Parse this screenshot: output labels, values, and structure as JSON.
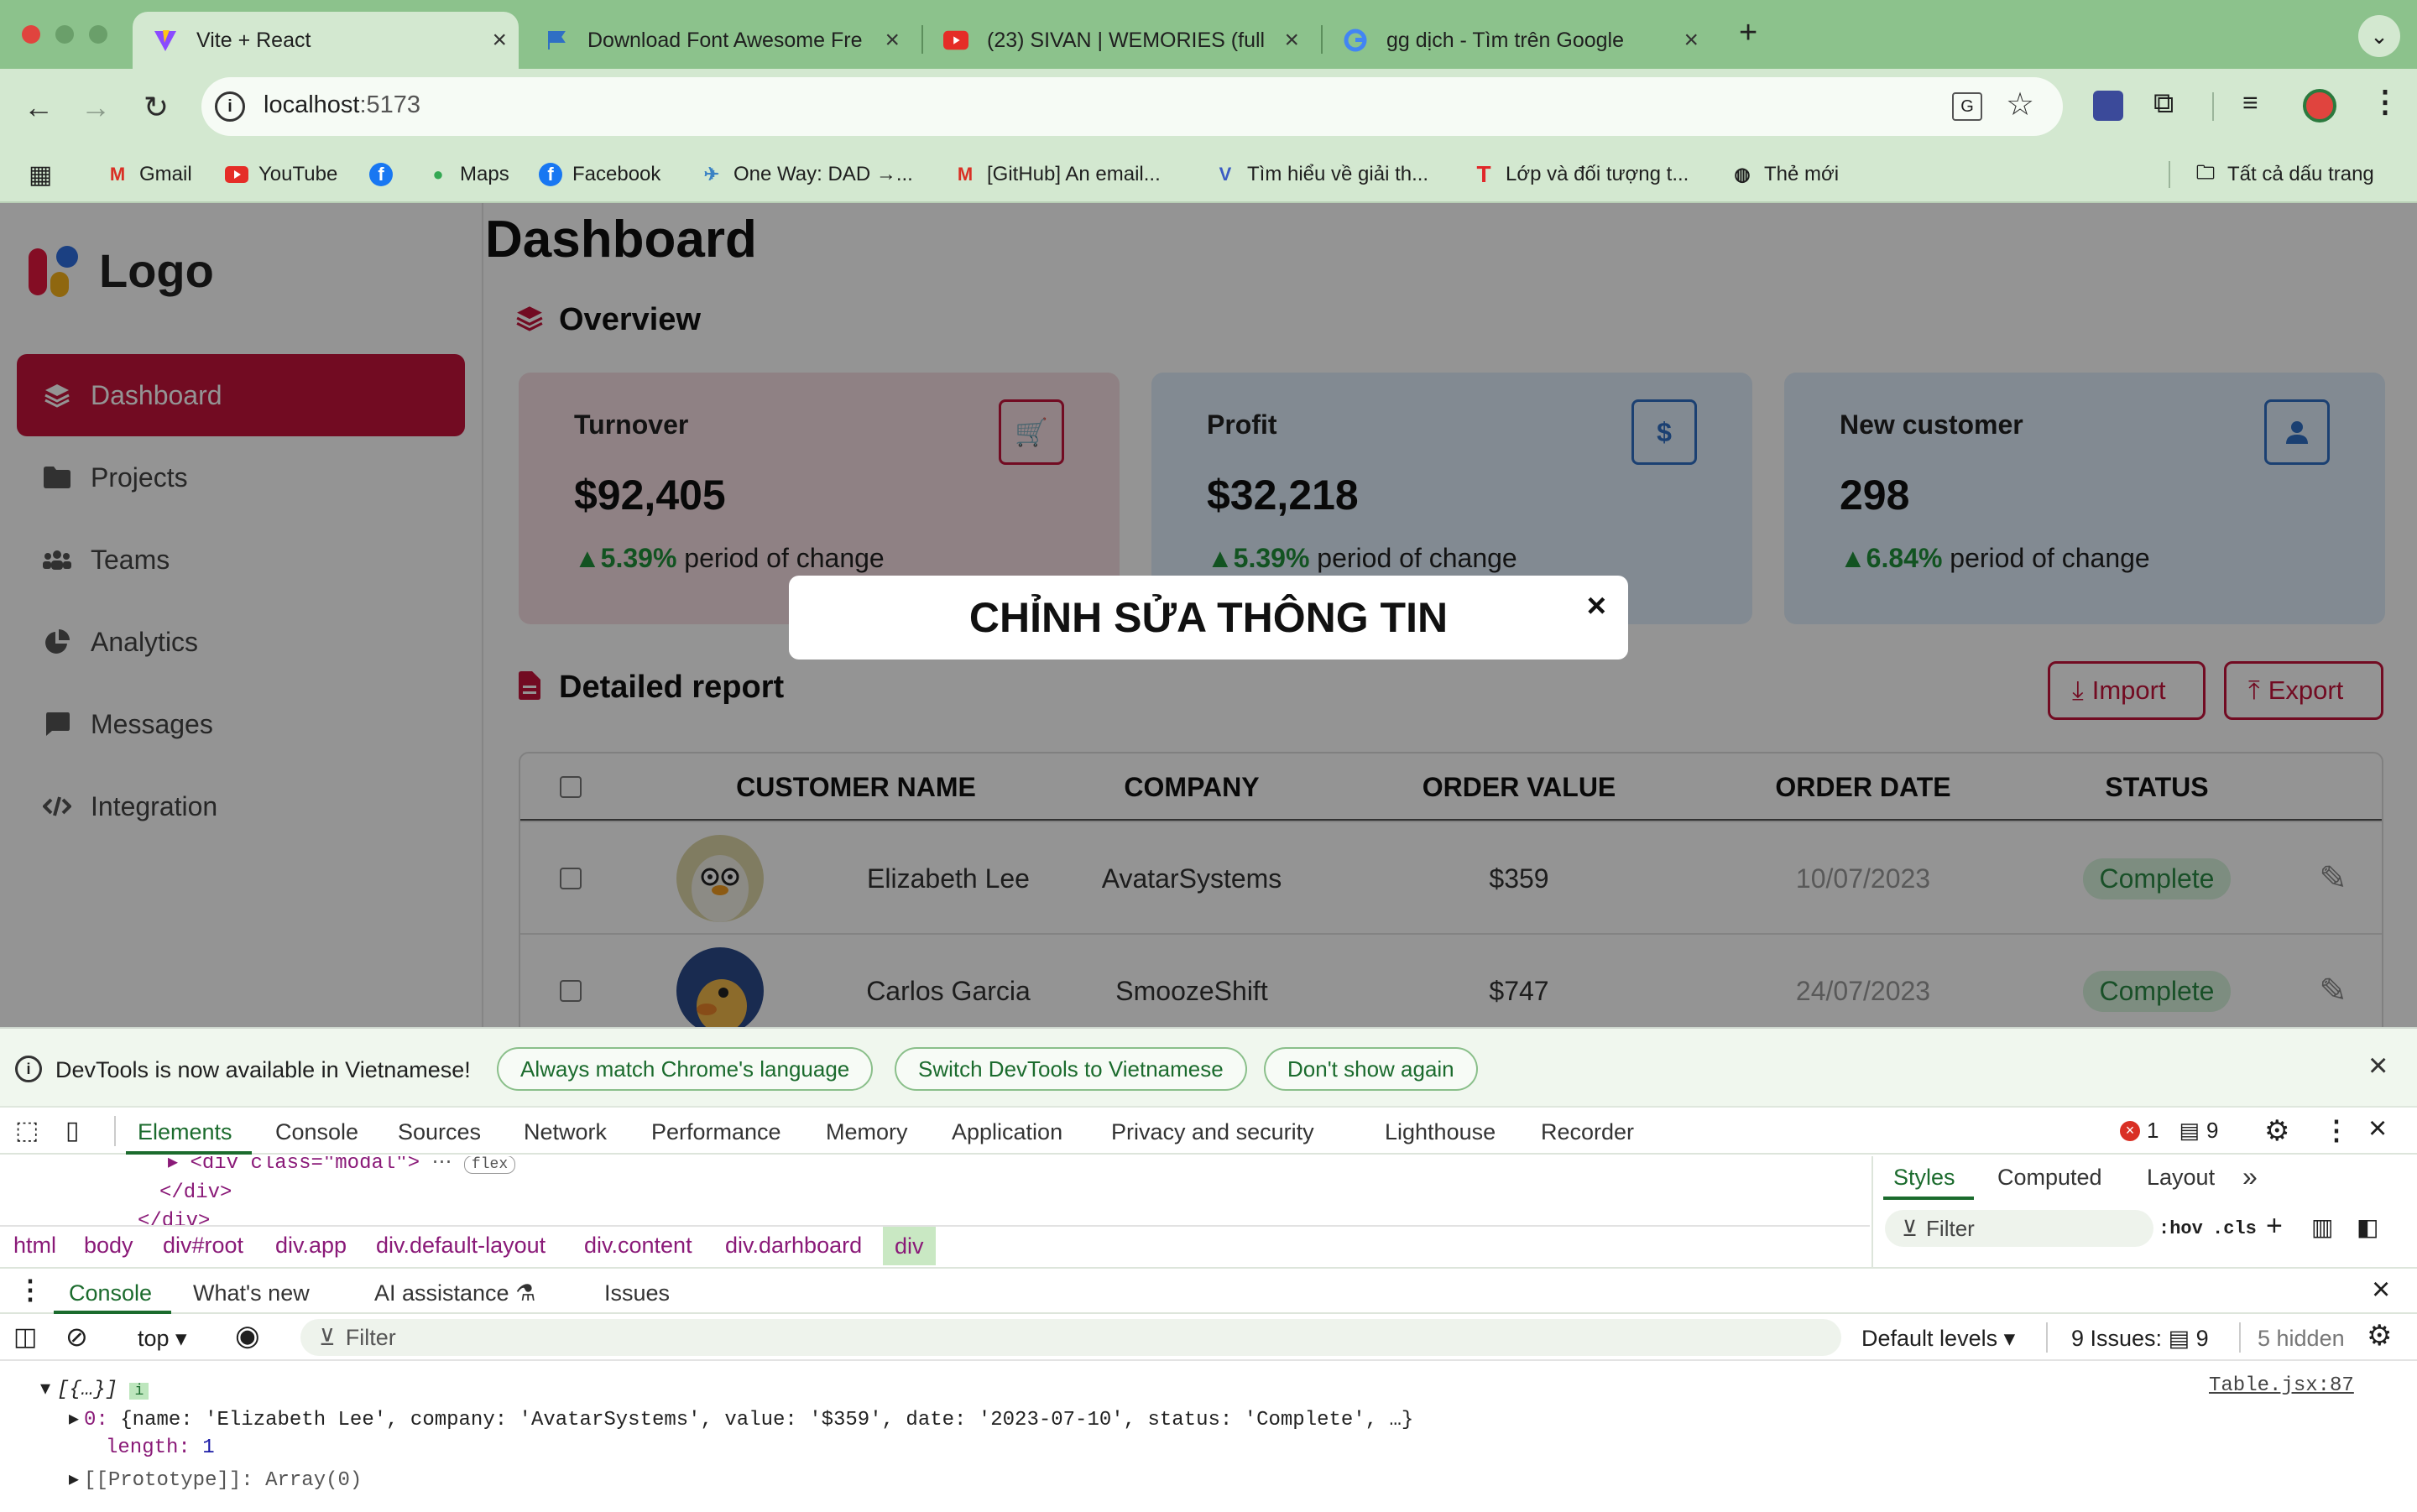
{
  "browser": {
    "tabs": [
      {
        "title": "Vite + React",
        "active": true
      },
      {
        "title": "Download Font Awesome Fre",
        "active": false
      },
      {
        "title": "(23) SIVAN | WEMORIES (full",
        "active": false
      },
      {
        "title": "gg dịch - Tìm trên Google",
        "active": false
      }
    ],
    "new_tab": "+",
    "address": "localhost",
    "address_port": ":5173",
    "bookmarks": [
      "Gmail",
      "YouTube",
      "",
      "Maps",
      "Facebook",
      "One Way: DAD →...",
      "[GitHub] An email...",
      "Tìm hiểu về giải th...",
      "Lớp và đối tượng t...",
      "Thẻ mới"
    ],
    "all_bookmarks": "Tất cả dấu trang"
  },
  "app": {
    "logo_text": "Logo",
    "page_title": "Dashboard",
    "sidebar": [
      {
        "label": "Dashboard",
        "icon": "layers-icon",
        "active": true
      },
      {
        "label": "Projects",
        "icon": "folder-icon"
      },
      {
        "label": "Teams",
        "icon": "users-icon"
      },
      {
        "label": "Analytics",
        "icon": "pie-chart-icon"
      },
      {
        "label": "Messages",
        "icon": "message-icon"
      },
      {
        "label": "Integration",
        "icon": "code-icon"
      }
    ],
    "overview_title": "Overview",
    "cards": [
      {
        "label": "Turnover",
        "value": "$92,405",
        "change": "5.39%",
        "change_text": "period of change",
        "icon": "cart-icon",
        "color": "#c4143c"
      },
      {
        "label": "Profit",
        "value": "$32,218",
        "change": "5.39%",
        "change_text": "period of change",
        "icon": "dollar-icon",
        "color": "#2f6fc4"
      },
      {
        "label": "New customer",
        "value": "298",
        "change": "6.84%",
        "change_text": "period of change",
        "icon": "user-icon",
        "color": "#2f6fc4"
      }
    ],
    "report_title": "Detailed report",
    "import_label": "Import",
    "export_label": "Export",
    "table": {
      "headers": [
        "CUSTOMER NAME",
        "COMPANY",
        "ORDER VALUE",
        "ORDER DATE",
        "STATUS"
      ],
      "rows": [
        {
          "name": "Elizabeth Lee",
          "company": "AvatarSystems",
          "value": "$359",
          "date": "10/07/2023",
          "status": "Complete"
        },
        {
          "name": "Carlos Garcia",
          "company": "SmoozeShift",
          "value": "$747",
          "date": "24/07/2023",
          "status": "Complete"
        }
      ]
    },
    "modal_title": "CHỈNH SỬA THÔNG TIN",
    "modal_close": "×"
  },
  "devtools": {
    "info_text": "DevTools is now available in Vietnamese!",
    "info_buttons": [
      "Always match Chrome's language",
      "Switch DevTools to Vietnamese",
      "Don't show again"
    ],
    "tabs": [
      "Elements",
      "Console",
      "Sources",
      "Network",
      "Performance",
      "Memory",
      "Application",
      "Privacy and security",
      "Lighthouse",
      "Recorder"
    ],
    "error_count": "1",
    "message_count": "9",
    "dom_line1": "<div class=\"modal\">",
    "dom_line1_badge": "flex",
    "dom_line2": "</div>",
    "dom_line3": "</div>",
    "breadcrumbs": [
      "html",
      "body",
      "div#root",
      "div.app",
      "div.default-layout",
      "div.content",
      "div.darhboard",
      "div"
    ],
    "styles_tabs": [
      "Styles",
      "Computed",
      "Layout"
    ],
    "styles_filter": "Filter",
    "styles_hov": ":hov",
    "styles_cls": ".cls",
    "drawer_tabs": [
      "Console",
      "What's new",
      "AI assistance",
      "Issues"
    ],
    "console_context": "top",
    "console_filter": "Filter",
    "default_levels": "Default levels",
    "issues_label": "9 Issues:",
    "issues_count": "9",
    "hidden_label": "5 hidden",
    "log_summary": "[{…}]",
    "log_source": "Table.jsx:87",
    "log_entry": "{name: 'Elizabeth Lee', company: 'AvatarSystems', value: '$359', date: '2023-07-10', status: 'Complete', …}",
    "log_length_key": "length",
    "log_length_val": "1",
    "log_proto": "[[Prototype]]: Array(0)"
  }
}
